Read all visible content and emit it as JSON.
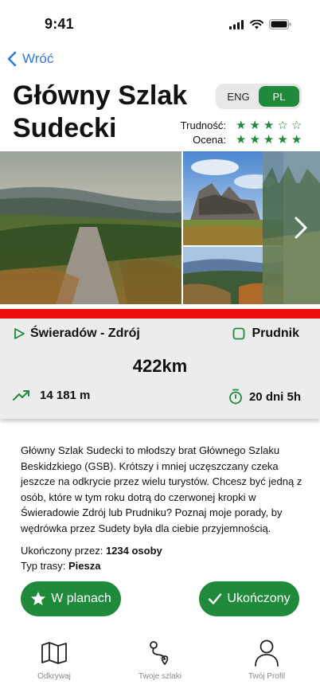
{
  "status": {
    "time": "9:41"
  },
  "nav": {
    "back_label": "Wróć"
  },
  "trail": {
    "title": "Główny Szlak Sudecki",
    "difficulty_label": "Trudność:",
    "difficulty_stars": 3,
    "rating_label": "Ocena:",
    "rating_stars": 5,
    "max_stars": 5
  },
  "language": {
    "options": [
      "ENG",
      "PL"
    ],
    "selected": "PL"
  },
  "route": {
    "start": "Świeradów - Zdrój",
    "end": "Prudnik",
    "distance": "422km",
    "elevation": "14 181 m",
    "duration": "20 dni 5h"
  },
  "description": "Główny Szlak Sudecki to młodszy brat Głównego Szlaku Beskidzkiego (GSB). Krótszy i mniej uczęszczany czeka jeszcze na odkrycie przez wielu  turystów. Chcesz być jedną z osób, które w tym roku dotrą do czerwonej  kropki w Świeradowie Zdrój lub Prudniku? Poznaj moje porady, by wędrówka przez Sudety była dla ciebie przyjemnością.",
  "meta": {
    "completed_label": "Ukończony przez: ",
    "completed_value": "1234 osoby",
    "type_label": "Typ trasy: ",
    "type_value": "Piesza"
  },
  "actions": {
    "plan_label": "W planach",
    "done_label": "Ukończony"
  },
  "tabs": [
    {
      "label": "Odkrywaj",
      "icon": "map-icon"
    },
    {
      "label": "Twoje szlaki",
      "icon": "route-icon"
    },
    {
      "label": "Twój Profil",
      "icon": "profile-icon"
    }
  ],
  "colors": {
    "accent": "#1e8a3a",
    "link": "#2c7be5",
    "trail_stripe": "#ee0d0d",
    "card": "#ececec"
  }
}
